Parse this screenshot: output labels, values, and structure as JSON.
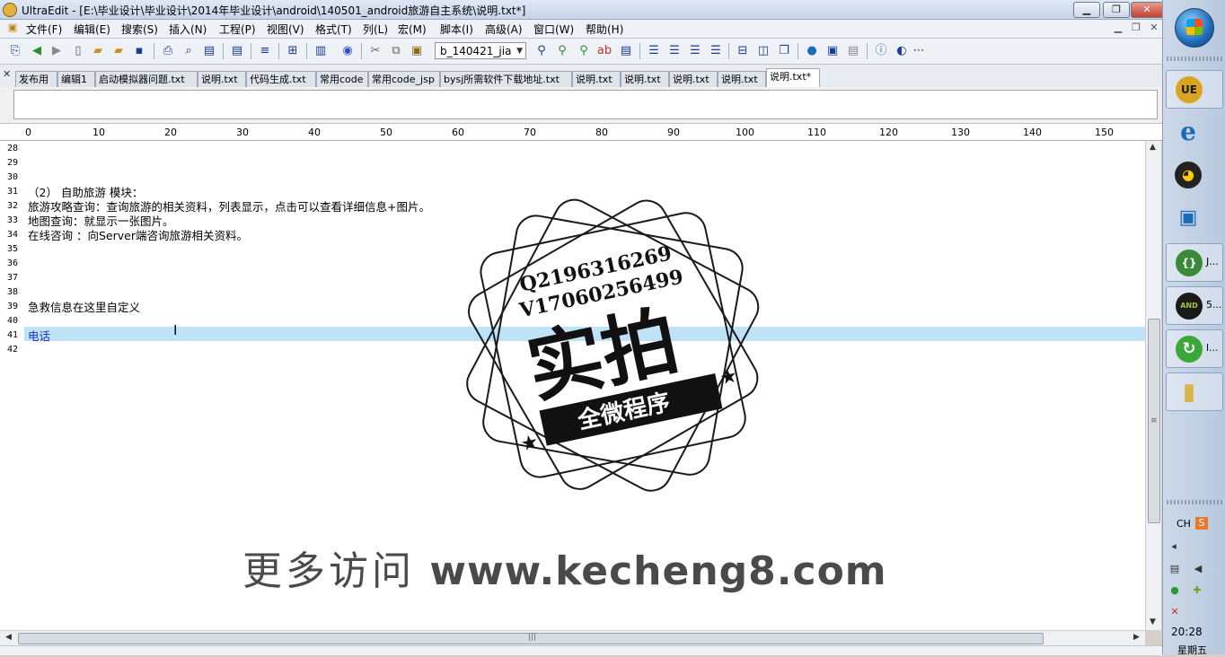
{
  "window": {
    "title": "UltraEdit - [E:\\毕业设计\\毕业设计\\2014年毕业设计\\android\\140501_android旅游自主系统\\说明.txt*]"
  },
  "menu": [
    "文件(F)",
    "编辑(E)",
    "搜索(S)",
    "插入(N)",
    "工程(P)",
    "视图(V)",
    "格式(T)",
    "列(L)",
    "宏(M)",
    "脚本(I)",
    "高级(A)",
    "窗口(W)",
    "帮助(H)"
  ],
  "toolbar": {
    "combo_value": "b_140421_jia"
  },
  "tabs": [
    "发布用",
    "编辑1",
    "启动模拟器问题.txt",
    "说明.txt",
    "代码生成.txt",
    "常用code",
    "常用code_jsp",
    "bysj所需软件下载地址.txt",
    "说明.txt",
    "说明.txt",
    "说明.txt",
    "说明.txt",
    "说明.txt*"
  ],
  "ruler": [
    "0",
    "10",
    "20",
    "30",
    "40",
    "50",
    "60",
    "70",
    "80",
    "90",
    "100",
    "110",
    "120",
    "130",
    "140",
    "150"
  ],
  "editor": {
    "lines": [
      {
        "n": "28",
        "t": ""
      },
      {
        "n": "29",
        "t": ""
      },
      {
        "n": "30",
        "t": ""
      },
      {
        "n": "31",
        "t": "（2） 自助旅游 模块："
      },
      {
        "n": "32",
        "t": "旅游攻略查询：查询旅游的相关资料，列表显示，点击可以查看详细信息+图片。"
      },
      {
        "n": "33",
        "t": "地图查询：就显示一张图片。"
      },
      {
        "n": "34",
        "t": "在线咨询 ：向Server端咨询旅游相关资料。"
      },
      {
        "n": "35",
        "t": ""
      },
      {
        "n": "36",
        "t": ""
      },
      {
        "n": "37",
        "t": ""
      },
      {
        "n": "38",
        "t": ""
      },
      {
        "n": "39",
        "t": "急救信息在这里自定义"
      },
      {
        "n": "40",
        "t": ""
      },
      {
        "n": "41",
        "t": "电话"
      },
      {
        "n": "42",
        "t": ""
      }
    ]
  },
  "watermark": {
    "q": "Q2196316269",
    "v": "V17060256499",
    "big": "实拍",
    "ribbon": "全微程序",
    "footer_cn": "更多访问",
    "footer_url": "www.kecheng8.com"
  },
  "taskbar": {
    "items": [
      {
        "icon": "ue-icon",
        "label": ""
      },
      {
        "icon": "ie-icon",
        "label": ""
      },
      {
        "icon": "qq-icon",
        "label": ""
      },
      {
        "icon": "network-computer-icon",
        "label": ""
      },
      {
        "icon": "json-icon",
        "label": "J..."
      },
      {
        "icon": "android-icon",
        "label": "5..."
      },
      {
        "icon": "refresh-app-icon",
        "label": "l..."
      },
      {
        "icon": "folder-icon",
        "label": ""
      }
    ],
    "lang": "CH",
    "time": "20:28",
    "day": "星期五"
  },
  "colors": {
    "highlight": "#bfe3f6",
    "blue_text": "#1c2fbf"
  }
}
